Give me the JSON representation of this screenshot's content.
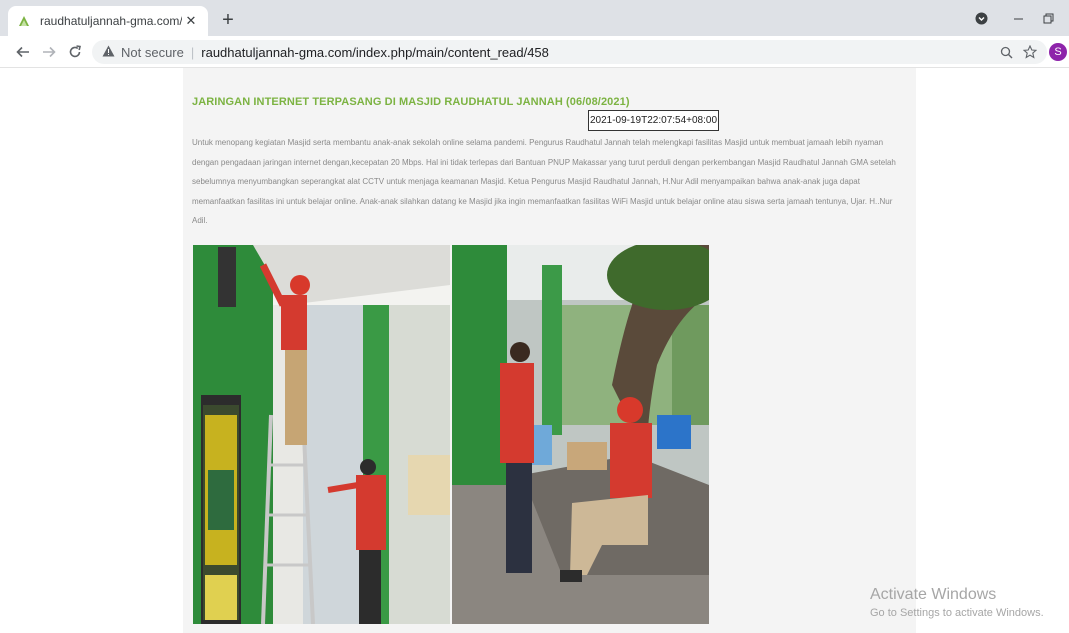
{
  "browser": {
    "tab_title": "raudhatuljannah-gma.com/index",
    "close_glyph": "✕",
    "new_tab_glyph": "+",
    "security_label": "Not secure",
    "url": "raudhatuljannah-gma.com/index.php/main/content_read/458",
    "profile_initial": "S",
    "profile_color": "#8e24aa"
  },
  "article": {
    "title": "JARINGAN INTERNET TERPASANG DI MASJID RAUDHATUL JANNAH (06/08/2021)",
    "timestamp": "2021-09-19T22:07:54+08:00",
    "body": "Untuk menopang kegiatan Masjid serta membantu anak-anak sekolah online selama pandemi. Pengurus Raudhatul Jannah telah melengkapi fasilitas Masjid untuk  membuat jamaah lebih nyaman dengan pengadaan jaringan internet  dengan,kecepatan 20 Mbps. Hal ini tidak terlepas dari Bantuan PNUP Makassar yang turut perduli dengan perkembangan  Masjid Raudhatul Jannah GMA setelah sebelumnya menyumbangkan seperangkat alat CCTV untuk menjaga keamanan Masjid. Ketua Pengurus Masjid Raudhatul Jannah, H.Nur Adil menyampaikan bahwa anak-anak juga dapat memanfaatkan fasilitas ini untuk belajar online. Anak-anak silahkan datang ke Masjid jika ingin memanfaatkan fasilitas WiFi Masjid untuk belajar online atau siswa serta jamaah tentunya, Ujar. H..Nur Adil.",
    "title_color": "#7cb342"
  },
  "watermark": {
    "line1": "Activate Windows",
    "line2": "Go to Settings to activate Windows."
  }
}
